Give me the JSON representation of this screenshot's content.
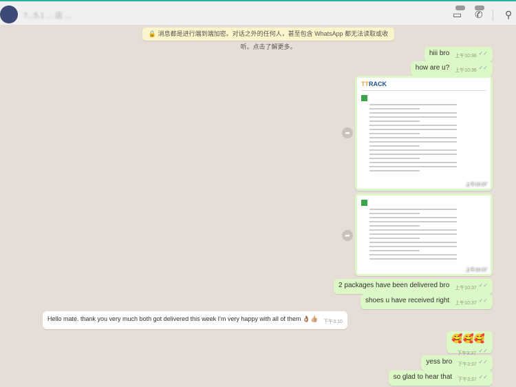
{
  "header": {
    "contact_name": "7...5.1 ... 店 ..."
  },
  "notice": "🔒 消息都是进行端到端加密。对话之外的任何人，甚至包含 WhatsApp 都无法读取或收听。点击了解更多。",
  "messages": [
    {
      "text": "hiii bro",
      "time": "上午10:36"
    },
    {
      "text": "how are u?",
      "time": "上午10:36"
    },
    {
      "image_logo": "TTRACK",
      "time": "上午10:37"
    },
    {
      "time": "上午10:37"
    },
    {
      "text": "2 packages have been delivered bro",
      "time": "上午10:37"
    },
    {
      "text": "shoes u have received right",
      "time": "上午10:37"
    },
    {
      "text": "Hello mate. thank you very much both got delivered this week I'm very happy with all of them 👌🏽👍🏼",
      "time": "下午3:10"
    },
    {
      "text": "🥰🥰🥰",
      "time": "下午3:37"
    },
    {
      "text": "yess bro",
      "time": "下午3:37"
    },
    {
      "text": "so glad to hear that",
      "time": "下午3:37"
    }
  ]
}
